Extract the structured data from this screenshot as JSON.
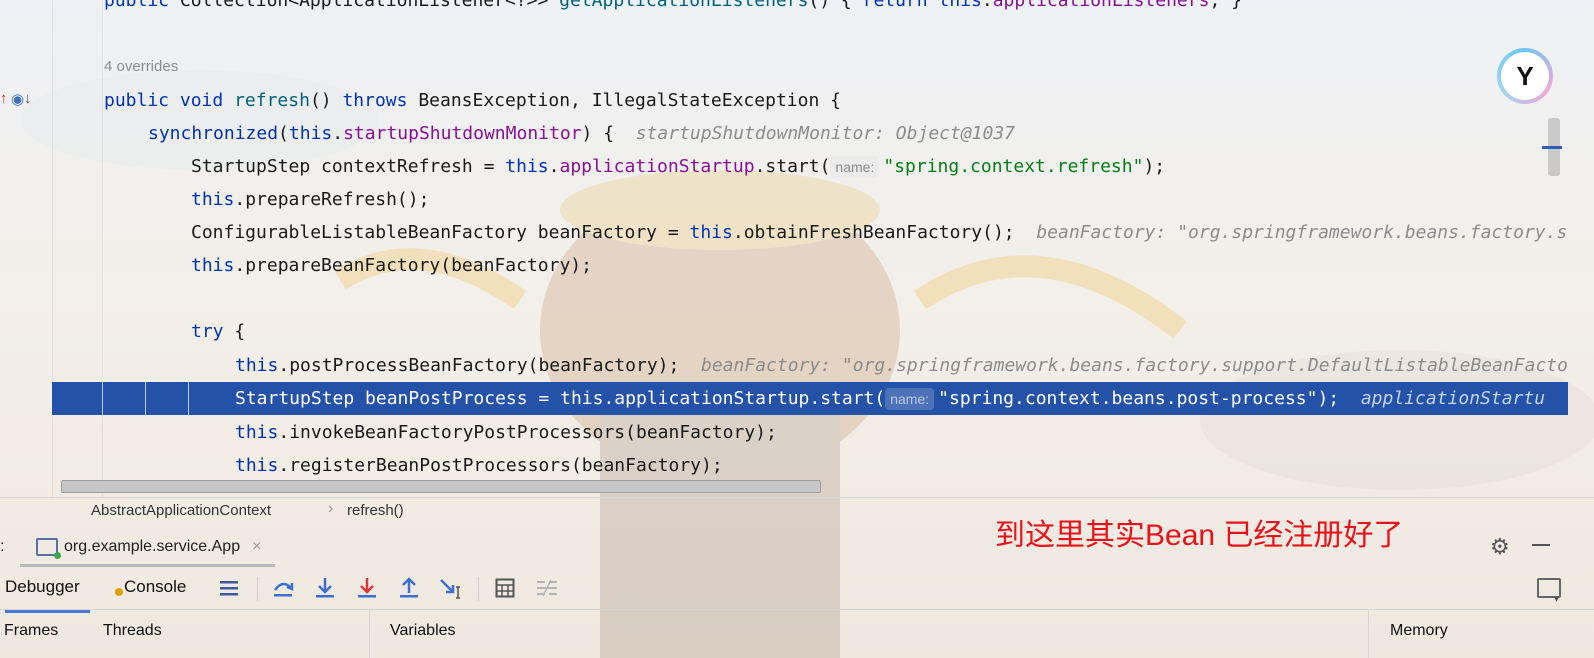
{
  "code": {
    "line0": {
      "kw1": "public",
      "type": " Collection<ApplicationListener<?>> ",
      "method": "getApplicationListeners",
      "rest": "() { ",
      "kw2": "return",
      "sp": " ",
      "kw3": "this",
      "dot": ".",
      "field": "applicationListeners",
      "end": "; }"
    },
    "overrides_label": "4 overrides",
    "line_refresh": {
      "kw1": "public",
      "kw2": "void",
      "method": "refresh",
      "mid": "() ",
      "kw3": "throws",
      "rest": " BeansException, IllegalStateException {"
    },
    "line_sync": {
      "kw1": "synchronized",
      "open": "(",
      "kw2": "this",
      "dot": ".",
      "field": "startupShutdownMonitor",
      "rest": ") {",
      "hint": "startupShutdownMonitor: Object@1037"
    },
    "line_startup": {
      "pre": "StartupStep contextRefresh = ",
      "kw": "this",
      "dot": ".",
      "field": "applicationStartup",
      "call": ".start(",
      "chip": "name:",
      "str": "\"spring.context.refresh\"",
      "end": ");"
    },
    "line_prepare": {
      "kw": "this",
      "rest": ".prepareRefresh();"
    },
    "line_factory": {
      "pre": "ConfigurableListableBeanFactory beanFactory = ",
      "kw": "this",
      "rest": ".obtainFreshBeanFactory();",
      "hint": "beanFactory: \"org.springframework.beans.factory.s"
    },
    "line_preparebf": {
      "kw": "this",
      "rest": ".prepareBeanFactory(beanFactory);"
    },
    "line_try": {
      "kw": "try",
      "rest": " {"
    },
    "line_post": {
      "kw": "this",
      "rest": ".postProcessBeanFactory(beanFactory);",
      "hint": "beanFactory: \"org.springframework.beans.factory.support.DefaultListableBeanFacto"
    },
    "line_highlight": {
      "pre": "StartupStep beanPostProcess = ",
      "kw": "this",
      "rest": ".applicationStartup.start(",
      "chip": "name:",
      "str": "\"spring.context.beans.post-process\"",
      "end": ");",
      "hint": "applicationStartu"
    },
    "line_invoke": {
      "kw": "this",
      "rest": ".invokeBeanFactoryPostProcessors(beanFactory);"
    },
    "line_register": {
      "kw": "this",
      "rest": ".registerBeanPostProcessors(beanFactory);"
    }
  },
  "breadcrumb": [
    "AbstractApplicationContext",
    "refresh()"
  ],
  "annotation": "到这里其实Bean 已经注册好了",
  "run": {
    "prefix": ":",
    "tab_label": "org.example.service.App",
    "close": "×"
  },
  "debug_tabs": {
    "debugger": "Debugger",
    "console": "Console"
  },
  "panels": {
    "frames": "Frames",
    "threads": "Threads",
    "variables": "Variables",
    "memory": "Memory"
  },
  "icons": [
    "show-execution-point-icon",
    "step-over-icon",
    "step-into-icon",
    "force-step-into-icon",
    "step-out-icon",
    "run-to-cursor-icon",
    "evaluate-expression-icon",
    "trace-current-stream-icon",
    "settings-icon",
    "minimize-icon",
    "layout-icon"
  ],
  "colors": {
    "selection": "#2352a8",
    "keyword": "#0033b3",
    "field": "#871094",
    "string": "#067d17",
    "annotation": "#e8131a"
  }
}
